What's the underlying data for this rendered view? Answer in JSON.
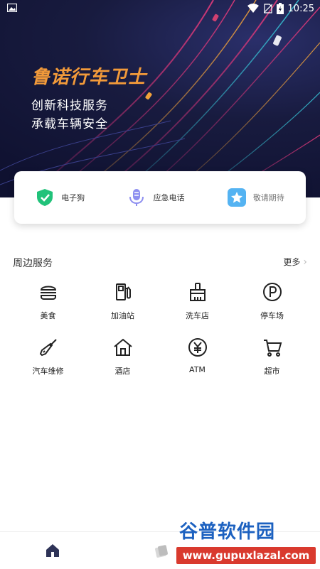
{
  "status_bar": {
    "time": "10:25",
    "icons": [
      "image-icon",
      "wifi-icon",
      "no-sim-icon",
      "battery-charging-icon"
    ]
  },
  "hero": {
    "brand": "鲁诺行车卫士",
    "slogan_line1": "创新科技服务",
    "slogan_line2": "承载车辆安全"
  },
  "quick_actions": [
    {
      "label": "电子狗",
      "icon": "shield-check-icon",
      "color": "#21c27a"
    },
    {
      "label": "应急电话",
      "icon": "microphone-icon",
      "color": "#8e8ff0"
    },
    {
      "label": "敬请期待",
      "icon": "star-icon",
      "color": "#54b3f2"
    }
  ],
  "nearby": {
    "title": "周边服务",
    "more_label": "更多",
    "items": [
      {
        "label": "美食",
        "icon": "burger-icon"
      },
      {
        "label": "加油站",
        "icon": "fuel-pump-icon"
      },
      {
        "label": "洗车店",
        "icon": "brush-icon"
      },
      {
        "label": "停车场",
        "icon": "parking-icon"
      },
      {
        "label": "汽车维修",
        "icon": "screwdriver-icon"
      },
      {
        "label": "酒店",
        "icon": "house-icon"
      },
      {
        "label": "ATM",
        "icon": "yen-icon"
      },
      {
        "label": "超市",
        "icon": "cart-icon"
      }
    ]
  },
  "bottom_nav": {
    "items": [
      {
        "icon": "home-icon",
        "active": true
      },
      {
        "icon": "card-icon",
        "active": false
      }
    ]
  },
  "watermark": {
    "title": "谷普软件园",
    "url": "www.gupuxlazal.com"
  },
  "colors": {
    "hero_bg": "#181b3f",
    "brand": "#f29a3a",
    "text_dark": "#222222"
  }
}
